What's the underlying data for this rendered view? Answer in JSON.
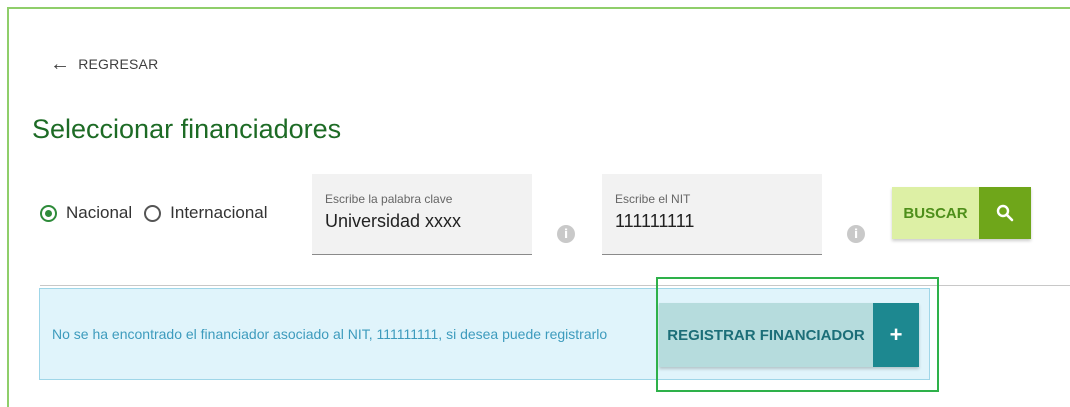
{
  "colors": {
    "frame": "#8fce6a",
    "title": "#1d6b25",
    "search_text_bg": "#ddf0a5",
    "search_icon_bg": "#6fa61a",
    "alert_bg": "#e0f4fb",
    "register_text_bg": "#b6dcdd",
    "register_icon_bg": "#1d8890",
    "highlight": "#2eb14a"
  },
  "nav": {
    "back_label": "REGRESAR",
    "back_icon": "arrow-left-icon"
  },
  "page": {
    "title": "Seleccionar financiadores"
  },
  "filters": {
    "radio_options": [
      {
        "label": "Nacional",
        "checked": true
      },
      {
        "label": "Internacional",
        "checked": false
      }
    ],
    "keyword": {
      "label": "Escribe la palabra clave",
      "value": "Universidad xxxx"
    },
    "nit": {
      "label": "Escribe el NIT",
      "value": "111111111"
    },
    "info_icon": "info-icon",
    "search_label": "BUSCAR",
    "search_icon": "search-icon"
  },
  "alert": {
    "message": "No se ha encontrado el financiador asociado al NIT, 111111111, si desea puede registrarlo",
    "register_label": "REGISTRAR FINANCIADOR",
    "register_icon": "plus-icon"
  }
}
